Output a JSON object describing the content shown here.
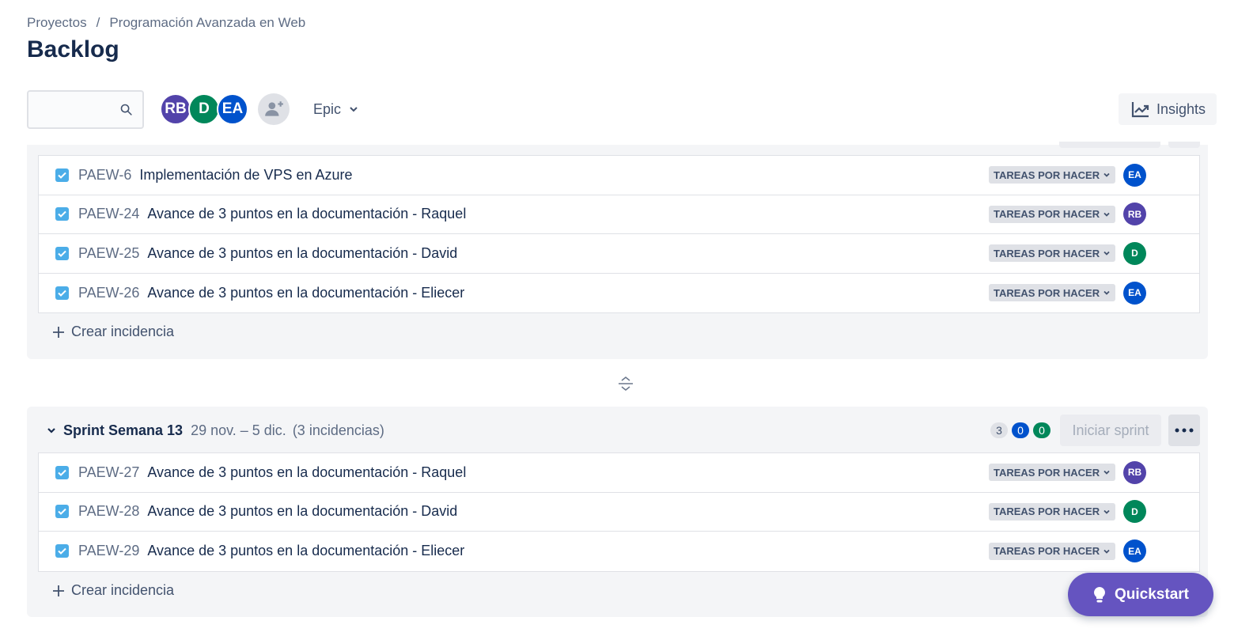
{
  "breadcrumb": {
    "projects": "Proyectos",
    "separator": "/",
    "project_name": "Programación Avanzada en Web"
  },
  "page_title": "Backlog",
  "toolbar": {
    "search_placeholder": "",
    "avatars": [
      {
        "initials": "RB",
        "color": "#5243aa"
      },
      {
        "initials": "D",
        "color": "#00875a"
      },
      {
        "initials": "EA",
        "color": "#0052cc"
      }
    ],
    "add_user_icon": "person-add-icon",
    "epic_label": "Epic",
    "insights_label": "Insights"
  },
  "sprint_a": {
    "issues": [
      {
        "key": "PAEW-6",
        "summary": "Implementación de VPS en Azure",
        "status": "TAREAS POR HACER",
        "assignee": "EA",
        "assignee_color": "#0052cc"
      },
      {
        "key": "PAEW-24",
        "summary": "Avance de 3 puntos en la documentación - Raquel",
        "status": "TAREAS POR HACER",
        "assignee": "RB",
        "assignee_color": "#5243aa"
      },
      {
        "key": "PAEW-25",
        "summary": "Avance de 3 puntos en la documentación - David",
        "status": "TAREAS POR HACER",
        "assignee": "D",
        "assignee_color": "#00875a"
      },
      {
        "key": "PAEW-26",
        "summary": "Avance de 3 puntos en la documentación - Eliecer",
        "status": "TAREAS POR HACER",
        "assignee": "EA",
        "assignee_color": "#0052cc"
      }
    ],
    "create_label": "Crear incidencia"
  },
  "sprint_b": {
    "name": "Sprint Semana 13",
    "dates": "29 nov. – 5 dic.",
    "count": "(3 incidencias)",
    "counters": {
      "todo": "3",
      "in_progress": "0",
      "done": "0"
    },
    "start_label": "Iniciar sprint",
    "issues": [
      {
        "key": "PAEW-27",
        "summary": "Avance de 3 puntos en la documentación - Raquel",
        "status": "TAREAS POR HACER",
        "assignee": "RB",
        "assignee_color": "#5243aa"
      },
      {
        "key": "PAEW-28",
        "summary": "Avance de 3 puntos en la documentación - David",
        "status": "TAREAS POR HACER",
        "assignee": "D",
        "assignee_color": "#00875a"
      },
      {
        "key": "PAEW-29",
        "summary": "Avance de 3 puntos en la documentación - Eliecer",
        "status": "TAREAS POR HACER",
        "assignee": "EA",
        "assignee_color": "#0052cc"
      }
    ],
    "create_label": "Crear incidencia"
  },
  "quickstart_label": "Quickstart",
  "colors": {
    "checkbox": "#4bade8",
    "counter_todo": "#dfe1e6",
    "counter_in_progress": "#0052cc",
    "counter_done": "#00875a",
    "quickstart": "#6554c0"
  }
}
